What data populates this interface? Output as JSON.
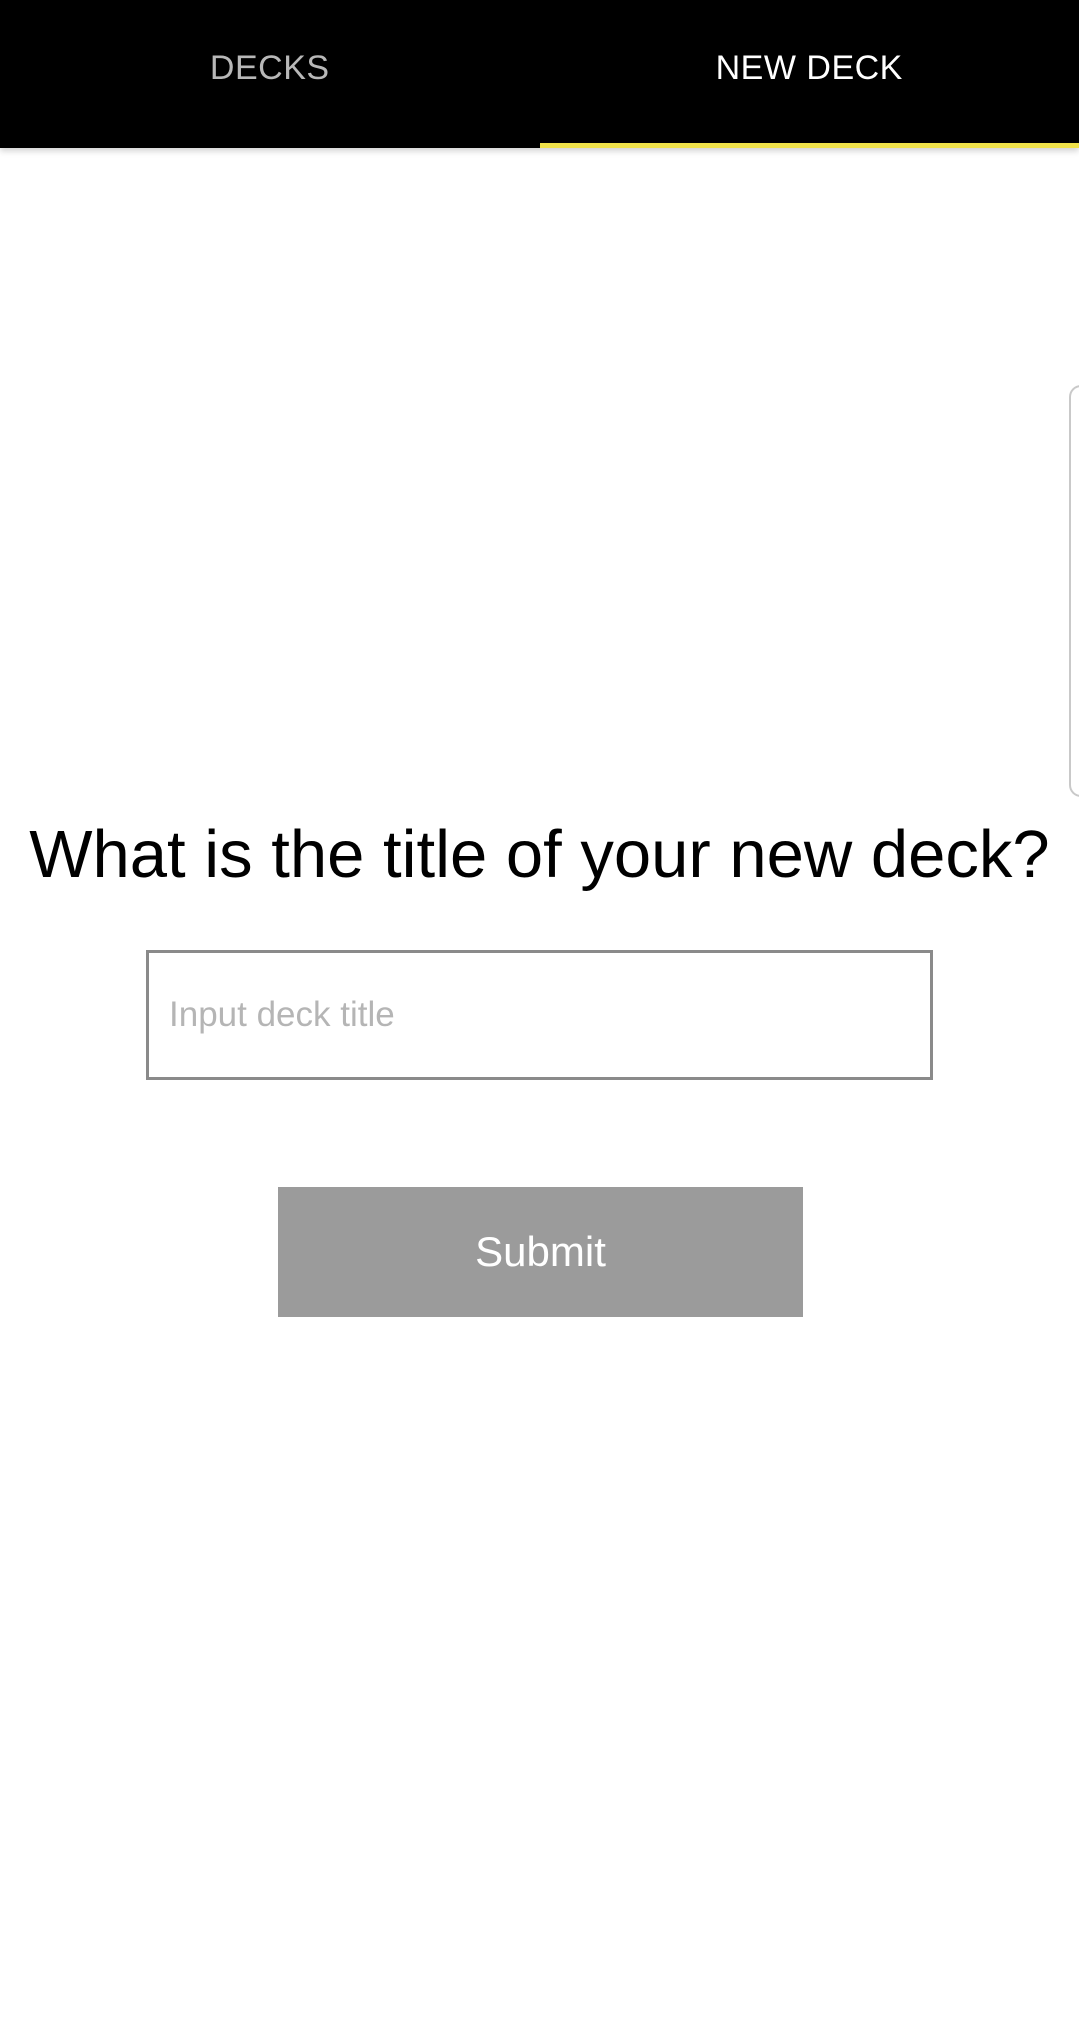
{
  "tabs": [
    {
      "label": "DECKS",
      "active": false
    },
    {
      "label": "NEW DECK",
      "active": true
    }
  ],
  "colors": {
    "tabbar_bg": "#000000",
    "active_indicator": "#f0e24a",
    "inactive_tab_text": "#b8b8b8",
    "active_tab_text": "#ffffff",
    "submit_bg": "#9b9b9b"
  },
  "form": {
    "question": "What is the title of your new deck?",
    "title_input": {
      "value": "",
      "placeholder": "Input deck title"
    },
    "submit_label": "Submit"
  }
}
